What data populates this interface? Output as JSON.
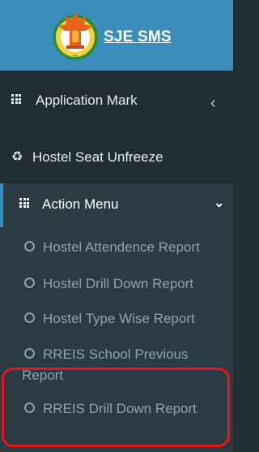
{
  "app": {
    "brand": "SJE SMS",
    "logo_icon": "government-emblem-logo"
  },
  "menu": [
    {
      "label": "Application Mark",
      "icon": "th-grid-icon",
      "chevron": "‹"
    },
    {
      "label": "Hostel Seat Unfreeze",
      "icon": "recycle-icon"
    },
    {
      "label": "Action Menu",
      "icon": "th-grid-icon",
      "chevron": "⌄"
    }
  ],
  "submenu": [
    {
      "label": "Hostel Attendence Report"
    },
    {
      "label": "Hostel Drill Down Report"
    },
    {
      "label": "Hostel Type Wise Report"
    },
    {
      "label": "RREIS School Previous",
      "label_cont": "Report"
    },
    {
      "label": "RREIS Drill Down Report"
    }
  ],
  "colors": {
    "header": "#3c8dbc",
    "sidebar": "#222d32",
    "submenu_bg": "#2c3b41",
    "highlight": "#e8141b"
  }
}
